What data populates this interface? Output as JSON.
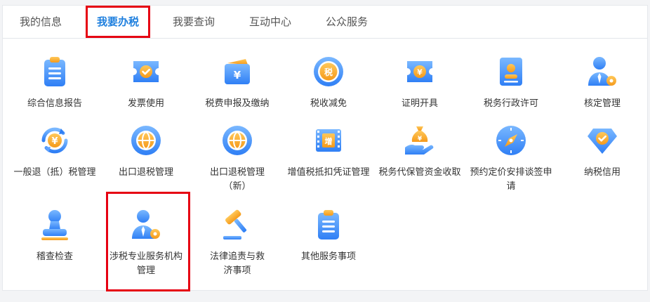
{
  "tabs": [
    {
      "label": "我的信息"
    },
    {
      "label": "我要办税"
    },
    {
      "label": "我要查询"
    },
    {
      "label": "互动中心"
    },
    {
      "label": "公众服务"
    }
  ],
  "active_tab": "我要办税",
  "colors": {
    "accent": "#1e7fde",
    "highlight": "#e60012",
    "icon_orange": "#f5a623"
  },
  "items": [
    {
      "label": "综合信息报告",
      "icon": "clipboard-list-icon"
    },
    {
      "label": "发票使用",
      "icon": "invoice-check-icon"
    },
    {
      "label": "税费申报及缴纳",
      "icon": "wallet-yuan-icon"
    },
    {
      "label": "税收减免",
      "icon": "tax-coin-icon"
    },
    {
      "label": "证明开具",
      "icon": "ticket-yuan-icon"
    },
    {
      "label": "税务行政许可",
      "icon": "stamp-icon"
    },
    {
      "label": "核定管理",
      "icon": "user-gear-icon"
    },
    {
      "label": "一般退（抵）税管理",
      "icon": "refund-cycle-icon"
    },
    {
      "label": "出口退税管理",
      "icon": "globe-icon"
    },
    {
      "label": "出口退税管理（新）",
      "icon": "globe-icon"
    },
    {
      "label": "增值税抵扣凭证管理",
      "icon": "vat-film-icon"
    },
    {
      "label": "税务代保管资金收取",
      "icon": "money-bag-hand-icon"
    },
    {
      "label": "预约定价安排谈签申请",
      "icon": "compass-icon"
    },
    {
      "label": "纳税信用",
      "icon": "diamond-check-icon"
    },
    {
      "label": "稽查检查",
      "icon": "stamp-person-icon"
    },
    {
      "label": "涉税专业服务机构管理",
      "icon": "user-gear-icon"
    },
    {
      "label": "法律追责与救济事项",
      "icon": "gavel-icon"
    },
    {
      "label": "其他服务事项",
      "icon": "clipboard-list-icon"
    }
  ]
}
